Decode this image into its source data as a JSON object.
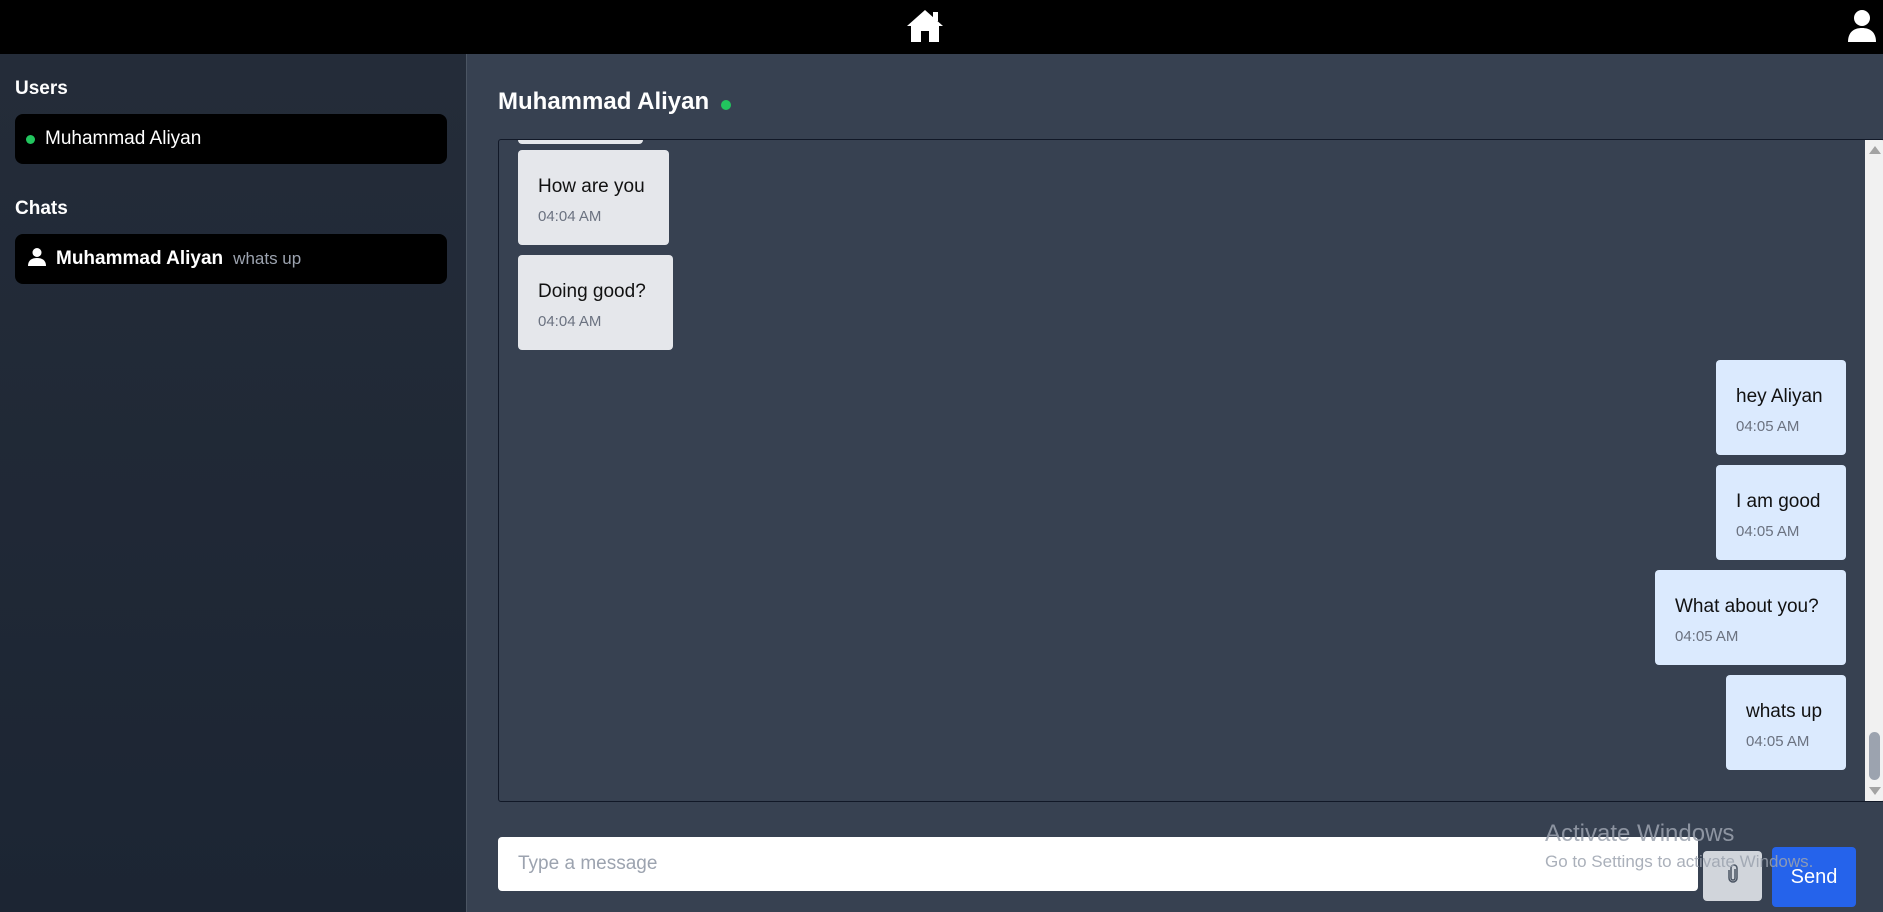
{
  "header": {
    "home_icon": "home-icon",
    "profile_icon": "user-icon"
  },
  "sidebar": {
    "users_heading": "Users",
    "users": [
      {
        "name": "Muhammad Aliyan",
        "status": "online"
      }
    ],
    "chats_heading": "Chats",
    "chats": [
      {
        "name": "Muhammad Aliyan",
        "last_message": "whats up"
      }
    ]
  },
  "conversation": {
    "title": "Muhammad Aliyan",
    "status": "online",
    "messages": [
      {
        "direction": "incoming",
        "text": "How are you",
        "time": "04:04 AM"
      },
      {
        "direction": "incoming",
        "text": "Doing good?",
        "time": "04:04 AM"
      },
      {
        "direction": "outgoing",
        "text": "hey Aliyan",
        "time": "04:05 AM"
      },
      {
        "direction": "outgoing",
        "text": "I am good",
        "time": "04:05 AM"
      },
      {
        "direction": "outgoing",
        "text": "What about you?",
        "time": "04:05 AM"
      },
      {
        "direction": "outgoing",
        "text": "whats up",
        "time": "04:05 AM"
      }
    ]
  },
  "composer": {
    "placeholder": "Type a message",
    "value": "",
    "attach_icon": "paperclip-icon",
    "send_label": "Send"
  },
  "watermark": {
    "line1": "Activate Windows",
    "line2": "Go to Settings to activate Windows."
  },
  "colors": {
    "accent": "#2563eb",
    "online": "#22c55e",
    "incoming_bubble": "#e5e7eb",
    "outgoing_bubble": "#dbeafe"
  }
}
